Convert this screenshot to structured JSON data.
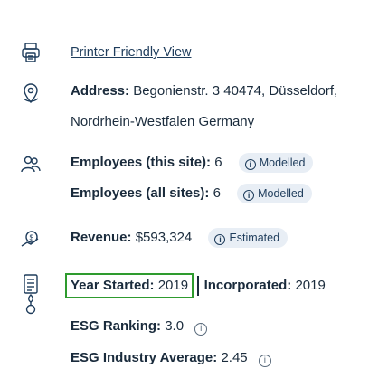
{
  "printer": {
    "link": "Printer Friendly View",
    "icon": "printer-icon"
  },
  "address": {
    "label": "Address:",
    "line1": "Begonienstr. 3 40474, Düsseldorf,",
    "line2": "Nordrhein-Westfalen Germany",
    "icon": "location-icon"
  },
  "employees": {
    "site_label": "Employees (this site):",
    "site_value": "6",
    "site_badge": "Modelled",
    "all_label": "Employees (all sites):",
    "all_value": "6",
    "all_badge": "Modelled",
    "icon": "employees-icon"
  },
  "revenue": {
    "label": "Revenue:",
    "value": "$593,324",
    "badge": "Estimated",
    "icon": "revenue-icon"
  },
  "year": {
    "label": "Year Started:",
    "value": "2019",
    "inc_label": "Incorporated:",
    "inc_value": "2019",
    "icon": "document-icon"
  },
  "esg": {
    "ranking_label": "ESG Ranking:",
    "ranking_value": "3.0",
    "avg_label": "ESG Industry Average:",
    "avg_value": "2.45",
    "icon": "esg-icon"
  },
  "badge_icon": "i",
  "colors": {
    "link": "#1f3d5c",
    "text": "#1a2b3c",
    "badge_bg": "#e8eef5",
    "focus_border": "#2e9b2e"
  }
}
